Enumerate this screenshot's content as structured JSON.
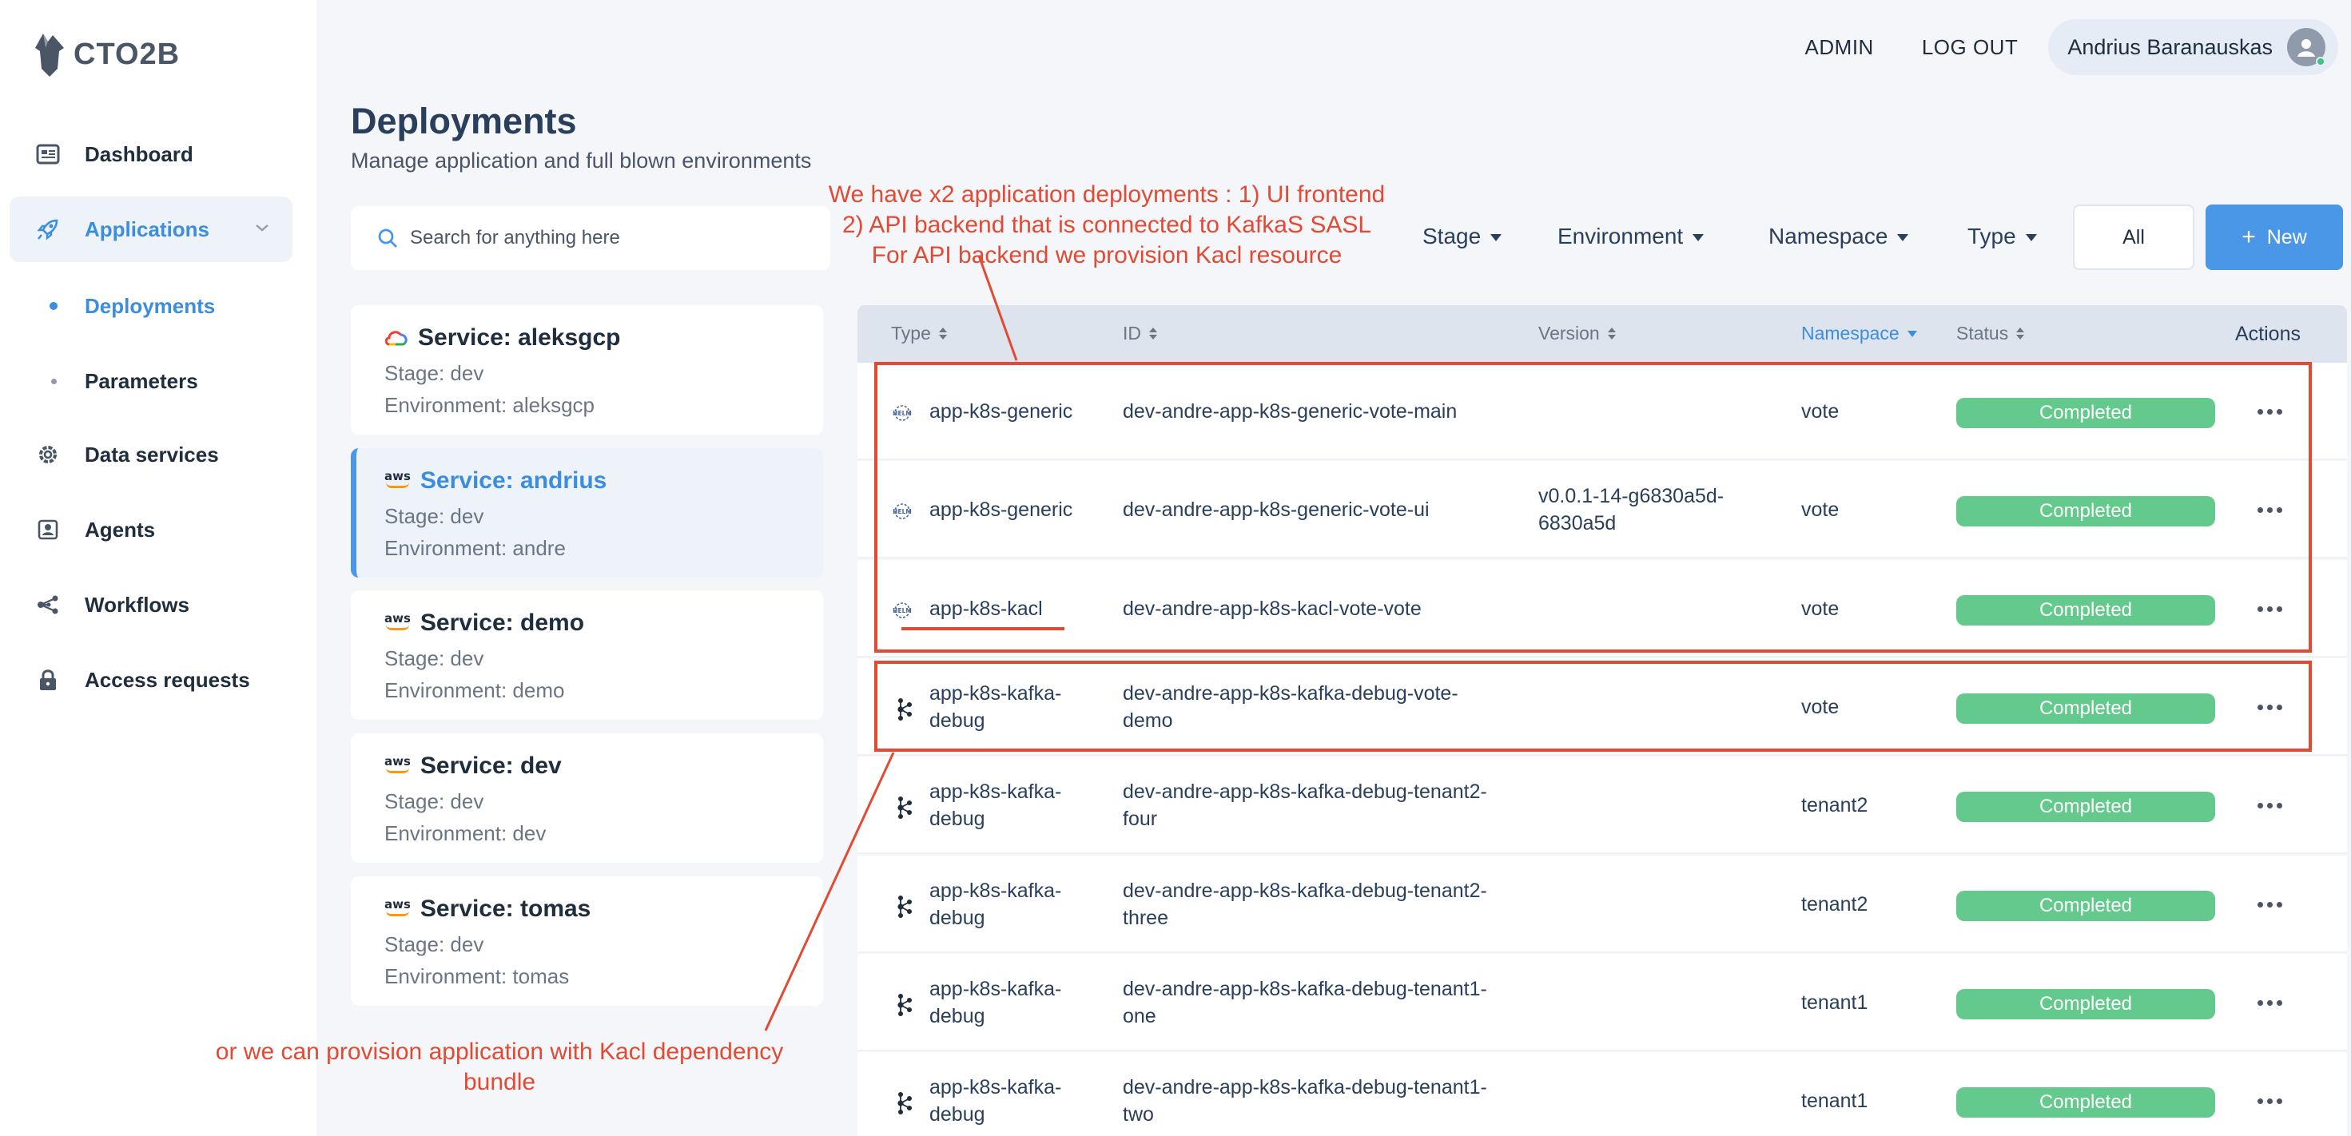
{
  "brand": {
    "logo_text": "CTO2B"
  },
  "sidebar": {
    "items": [
      {
        "label": "Dashboard"
      },
      {
        "label": "Applications"
      },
      {
        "label": "Data services"
      },
      {
        "label": "Agents"
      },
      {
        "label": "Workflows"
      },
      {
        "label": "Access requests"
      }
    ],
    "subitems": [
      {
        "label": "Deployments"
      },
      {
        "label": "Parameters"
      }
    ]
  },
  "topbar": {
    "admin": "ADMIN",
    "logout": "LOG OUT",
    "user_name": "Andrius Baranauskas"
  },
  "header": {
    "title": "Deployments",
    "subtitle": "Manage application and full blown environments"
  },
  "search": {
    "placeholder": "Search for anything here"
  },
  "filters": {
    "stage": "Stage",
    "environment": "Environment",
    "namespace": "Namespace",
    "type": "Type",
    "all": "All",
    "new": "New"
  },
  "services": [
    {
      "title": "Service: aleksgcp",
      "stage": "Stage: dev",
      "environment": "Environment: aleksgcp",
      "provider": "gcp-icon"
    },
    {
      "title": "Service: andrius",
      "stage": "Stage: dev",
      "environment": "Environment: andre",
      "provider": "aws",
      "selected": true
    },
    {
      "title": "Service: demo",
      "stage": "Stage: dev",
      "environment": "Environment: demo",
      "provider": "aws"
    },
    {
      "title": "Service: dev",
      "stage": "Stage: dev",
      "environment": "Environment: dev",
      "provider": "aws"
    },
    {
      "title": "Service: tomas",
      "stage": "Stage: dev",
      "environment": "Environment: tomas",
      "provider": "aws"
    }
  ],
  "table": {
    "headers": {
      "type": "Type",
      "id": "ID",
      "version": "Version",
      "namespace": "Namespace",
      "status": "Status",
      "actions": "Actions"
    },
    "rows": [
      {
        "type": "app-k8s-generic",
        "icon": "helm-icon",
        "id": "dev-andre-app-k8s-generic-vote-main",
        "version": "",
        "namespace": "vote",
        "status": "Completed"
      },
      {
        "type": "app-k8s-generic",
        "icon": "helm-icon",
        "id": "dev-andre-app-k8s-generic-vote-ui",
        "version": "v0.0.1-14-g6830a5d-6830a5d",
        "namespace": "vote",
        "status": "Completed"
      },
      {
        "type": "app-k8s-kacl",
        "icon": "helm-icon",
        "id": "dev-andre-app-k8s-kacl-vote-vote",
        "version": "",
        "namespace": "vote",
        "status": "Completed"
      },
      {
        "type": "app-k8s-kafka-debug",
        "icon": "kafka-icon",
        "id": "dev-andre-app-k8s-kafka-debug-vote-demo",
        "version": "",
        "namespace": "vote",
        "status": "Completed"
      },
      {
        "type": "app-k8s-kafka-debug",
        "icon": "kafka-icon",
        "id": "dev-andre-app-k8s-kafka-debug-tenant2-four",
        "version": "",
        "namespace": "tenant2",
        "status": "Completed"
      },
      {
        "type": "app-k8s-kafka-debug",
        "icon": "kafka-icon",
        "id": "dev-andre-app-k8s-kafka-debug-tenant2-three",
        "version": "",
        "namespace": "tenant2",
        "status": "Completed"
      },
      {
        "type": "app-k8s-kafka-debug",
        "icon": "kafka-icon",
        "id": "dev-andre-app-k8s-kafka-debug-tenant1-one",
        "version": "",
        "namespace": "tenant1",
        "status": "Completed"
      },
      {
        "type": "app-k8s-kafka-debug",
        "icon": "kafka-icon",
        "id": "dev-andre-app-k8s-kafka-debug-tenant1-two",
        "version": "",
        "namespace": "tenant1",
        "status": "Completed"
      }
    ]
  },
  "annotations": {
    "top_line1": "We have x2 application deployments : 1) UI frontend",
    "top_line2": "2) API backend that is connected to KafkaS SASL",
    "top_line3": "For API backend we provision Kacl resource",
    "bottom_line1": "or we can provision application with Kacl dependency",
    "bottom_line2": "bundle"
  },
  "colors": {
    "accent": "#4a97e8",
    "status_completed": "#64c98c",
    "annotation": "#e34a33"
  }
}
